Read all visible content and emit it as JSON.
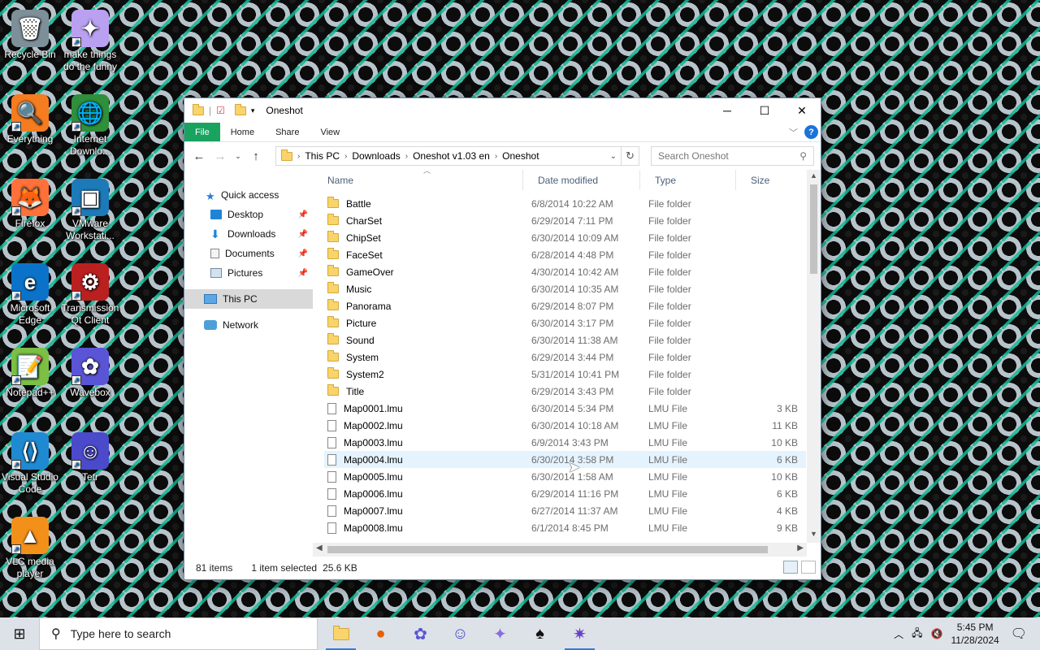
{
  "desktop": {
    "icons": [
      {
        "label": "Recycle Bin",
        "glyph": "🗑"
      },
      {
        "label": "make things do the funny",
        "glyph": "✦"
      },
      {
        "label": "Everything",
        "glyph": "🔍"
      },
      {
        "label": "Internet Downlo...",
        "glyph": "🌐"
      },
      {
        "label": "Firefox",
        "glyph": "🦊"
      },
      {
        "label": "VMware Workstati...",
        "glyph": "▣"
      },
      {
        "label": "Microsoft Edge",
        "glyph": "e"
      },
      {
        "label": "Transmission Qt Client",
        "glyph": "⚙"
      },
      {
        "label": "Notepad++",
        "glyph": "📝"
      },
      {
        "label": "Wavebox",
        "glyph": "✿"
      },
      {
        "label": "Visual Studio Code",
        "glyph": "⟨⟩"
      },
      {
        "label": "Tetr",
        "glyph": "☺"
      },
      {
        "label": "VLC media player",
        "glyph": "▲"
      }
    ]
  },
  "window": {
    "title": "Oneshot",
    "ribbon_tabs": [
      "File",
      "Home",
      "Share",
      "View"
    ],
    "breadcrumb": [
      "This PC",
      "Downloads",
      "Oneshot v1.03 en",
      "Oneshot"
    ],
    "search_placeholder": "Search Oneshot",
    "nav_pane": {
      "quick_access": "Quick access",
      "items": [
        "Desktop",
        "Downloads",
        "Documents",
        "Pictures"
      ],
      "this_pc": "This PC",
      "network": "Network"
    },
    "columns": {
      "name": "Name",
      "date": "Date modified",
      "type": "Type",
      "size": "Size"
    },
    "rows": [
      {
        "name": "Battle",
        "date": "6/8/2014 10:22 AM",
        "type": "File folder",
        "size": "",
        "kind": "folder"
      },
      {
        "name": "CharSet",
        "date": "6/29/2014 7:11 PM",
        "type": "File folder",
        "size": "",
        "kind": "folder"
      },
      {
        "name": "ChipSet",
        "date": "6/30/2014 10:09 AM",
        "type": "File folder",
        "size": "",
        "kind": "folder"
      },
      {
        "name": "FaceSet",
        "date": "6/28/2014 4:48 PM",
        "type": "File folder",
        "size": "",
        "kind": "folder"
      },
      {
        "name": "GameOver",
        "date": "4/30/2014 10:42 AM",
        "type": "File folder",
        "size": "",
        "kind": "folder"
      },
      {
        "name": "Music",
        "date": "6/30/2014 10:35 AM",
        "type": "File folder",
        "size": "",
        "kind": "folder"
      },
      {
        "name": "Panorama",
        "date": "6/29/2014 8:07 PM",
        "type": "File folder",
        "size": "",
        "kind": "folder"
      },
      {
        "name": "Picture",
        "date": "6/30/2014 3:17 PM",
        "type": "File folder",
        "size": "",
        "kind": "folder"
      },
      {
        "name": "Sound",
        "date": "6/30/2014 11:38 AM",
        "type": "File folder",
        "size": "",
        "kind": "folder"
      },
      {
        "name": "System",
        "date": "6/29/2014 3:44 PM",
        "type": "File folder",
        "size": "",
        "kind": "folder"
      },
      {
        "name": "System2",
        "date": "5/31/2014 10:41 PM",
        "type": "File folder",
        "size": "",
        "kind": "folder"
      },
      {
        "name": "Title",
        "date": "6/29/2014 3:43 PM",
        "type": "File folder",
        "size": "",
        "kind": "folder"
      },
      {
        "name": "Map0001.lmu",
        "date": "6/30/2014 5:34 PM",
        "type": "LMU File",
        "size": "3 KB",
        "kind": "file"
      },
      {
        "name": "Map0002.lmu",
        "date": "6/30/2014 10:18 AM",
        "type": "LMU File",
        "size": "11 KB",
        "kind": "file"
      },
      {
        "name": "Map0003.lmu",
        "date": "6/9/2014 3:43 PM",
        "type": "LMU File",
        "size": "10 KB",
        "kind": "file"
      },
      {
        "name": "Map0004.lmu",
        "date": "6/30/2014 3:58 PM",
        "type": "LMU File",
        "size": "6 KB",
        "kind": "file"
      },
      {
        "name": "Map0005.lmu",
        "date": "6/30/2014 1:58 AM",
        "type": "LMU File",
        "size": "10 KB",
        "kind": "file"
      },
      {
        "name": "Map0006.lmu",
        "date": "6/29/2014 11:16 PM",
        "type": "LMU File",
        "size": "6 KB",
        "kind": "file"
      },
      {
        "name": "Map0007.lmu",
        "date": "6/27/2014 11:37 AM",
        "type": "LMU File",
        "size": "4 KB",
        "kind": "file"
      },
      {
        "name": "Map0008.lmu",
        "date": "6/1/2014 8:45 PM",
        "type": "LMU File",
        "size": "9 KB",
        "kind": "file"
      }
    ],
    "hovered_row": 15,
    "status": {
      "count": "81 items",
      "selected": "1 item selected",
      "size": "25.6 KB"
    }
  },
  "taskbar": {
    "search_placeholder": "Type here to search",
    "time": "5:45 PM",
    "date": "11/28/2024"
  },
  "colors": {
    "file_tab": "#19a35f",
    "accent": "#3b78d8",
    "row_hover": "#e5f3ff"
  }
}
